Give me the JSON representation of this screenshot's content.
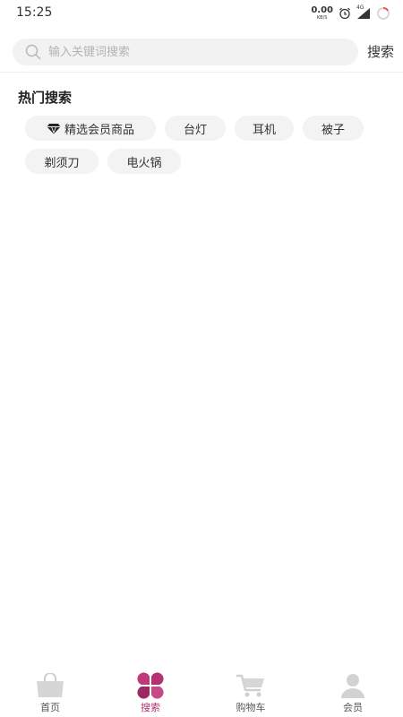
{
  "status_bar": {
    "time": "15:25",
    "net_speed": "0.00",
    "net_unit": "KB/S",
    "network_type": "4G"
  },
  "search": {
    "placeholder": "输入关键词搜索",
    "value": "",
    "button_label": "搜索"
  },
  "hot_search": {
    "title": "热门搜索",
    "tags": [
      "精选会员商品",
      "台灯",
      "耳机",
      "被子",
      "剃须刀",
      "电火锅"
    ]
  },
  "tabbar": {
    "items": [
      {
        "label": "首页",
        "icon": "shopping-bag-icon",
        "active": false
      },
      {
        "label": "搜索",
        "icon": "clover-icon",
        "active": true
      },
      {
        "label": "购物车",
        "icon": "cart-icon",
        "active": false
      },
      {
        "label": "会员",
        "icon": "person-icon",
        "active": false
      }
    ]
  },
  "colors": {
    "accent": "#b0306e",
    "tag_bg": "#f3f3f3",
    "search_bg": "#f2f2f2",
    "inactive_icon": "#cfcfcf"
  }
}
